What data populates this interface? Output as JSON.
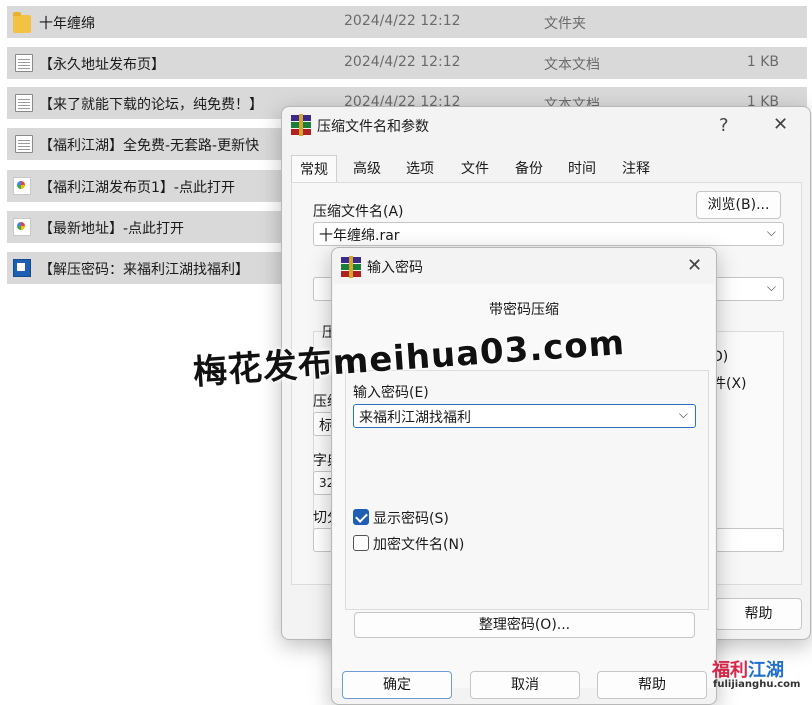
{
  "files": [
    {
      "name": "十年缠绵",
      "date": "2024/4/22 12:12",
      "type": "文件夹",
      "size": "",
      "icon": "folder-icon"
    },
    {
      "name": "【永久地址发布页】",
      "date": "2024/4/22 12:12",
      "type": "文本文档",
      "size": "1 KB",
      "icon": "text-document-icon"
    },
    {
      "name": "【来了就能下载的论坛，纯免费！】",
      "date": "2024/4/22 12:12",
      "type": "文本文档",
      "size": "1 KB",
      "icon": "text-document-icon"
    },
    {
      "name": "【福利江湖】全免费-无套路-更新快",
      "date": "",
      "type": "",
      "size": "",
      "icon": "text-document-icon"
    },
    {
      "name": "【福利江湖发布页1】-点此打开",
      "date": "",
      "type": "",
      "size": "",
      "icon": "web-shortcut-icon"
    },
    {
      "name": "【最新地址】-点此打开",
      "date": "",
      "type": "",
      "size": "",
      "icon": "web-shortcut-icon"
    },
    {
      "name": "【解压密码：来福利江湖找福利】",
      "date": "",
      "type": "",
      "size": "",
      "icon": "url-shortcut-icon"
    }
  ],
  "archive_dialog": {
    "title": "压缩文件名和参数",
    "help_glyph": "?",
    "close_glyph": "✕",
    "tabs": [
      "常规",
      "高级",
      "选项",
      "文件",
      "备份",
      "时间",
      "注释"
    ],
    "active_tab": "常规",
    "archive_name_label": "压缩文件名(A)",
    "archive_name_value": "十年缠绵.rar",
    "browse_label": "浏览(B)...",
    "partial_labels": {
      "group": "压",
      "format": "压缩",
      "method_value": "标",
      "dict": "字典",
      "dict_value": "32",
      "split": "切分"
    },
    "partial_right": {
      "line1": "D)",
      "line2": "件(X)"
    },
    "help_button": "帮助"
  },
  "password_dialog": {
    "title": "输入密码",
    "close_glyph": "✕",
    "heading": "带密码压缩",
    "password_label": "输入密码(E)",
    "password_value": "来福利江湖找福利",
    "show_password_label": "显示密码(S)",
    "show_password_checked": true,
    "encrypt_names_label": "加密文件名(N)",
    "encrypt_names_checked": false,
    "organize_button": "整理密码(O)...",
    "ok_button": "确定",
    "cancel_button": "取消",
    "help_button": "帮助"
  },
  "watermark": {
    "text": "梅花发布meihua03.com"
  },
  "logo": {
    "title_red": "福利",
    "title_blue": "江湖",
    "subtitle": "fulijianghu.com"
  },
  "colors": {
    "accent": "#1f5fb3",
    "row_highlight": "#d9d9d9",
    "dialog_bg": "#f3f3f3"
  }
}
